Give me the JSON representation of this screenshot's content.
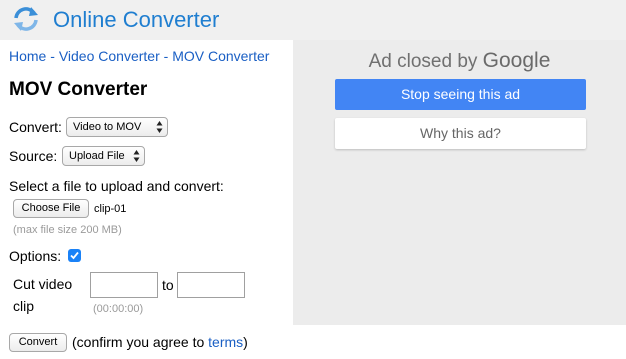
{
  "header": {
    "site_name": "Online Converter",
    "logo_icon": "refresh-arrows-icon",
    "accent": "#1f7ed0"
  },
  "breadcrumb": {
    "items": [
      "Home",
      "Video Converter",
      "MOV Converter"
    ],
    "separator": " - "
  },
  "page_title": "MOV Converter",
  "form": {
    "convert_label": "Convert:",
    "convert_value": "Video to MOV",
    "source_label": "Source:",
    "source_value": "Upload File",
    "upload_prompt": "Select a file to upload and convert:",
    "choose_file_label": "Choose File",
    "file_name": "clip-01",
    "max_size_note": "(max file size 200 MB)",
    "options_label": "Options:",
    "options_checked": true,
    "cut_label_line1": "Cut video",
    "cut_label_line2": "clip",
    "cut_to": "to",
    "cut_start_value": "",
    "cut_end_value": "",
    "time_format_hint": "(00:00:00)",
    "convert_button": "Convert",
    "confirm_prefix": "(confirm you agree to ",
    "terms_link": "terms",
    "confirm_suffix": ")"
  },
  "ad": {
    "closed_text": "Ad closed by",
    "brand": "Google",
    "stop_button": "Stop seeing this ad",
    "why_button": "Why this ad?",
    "primary_color": "#4285f4"
  }
}
